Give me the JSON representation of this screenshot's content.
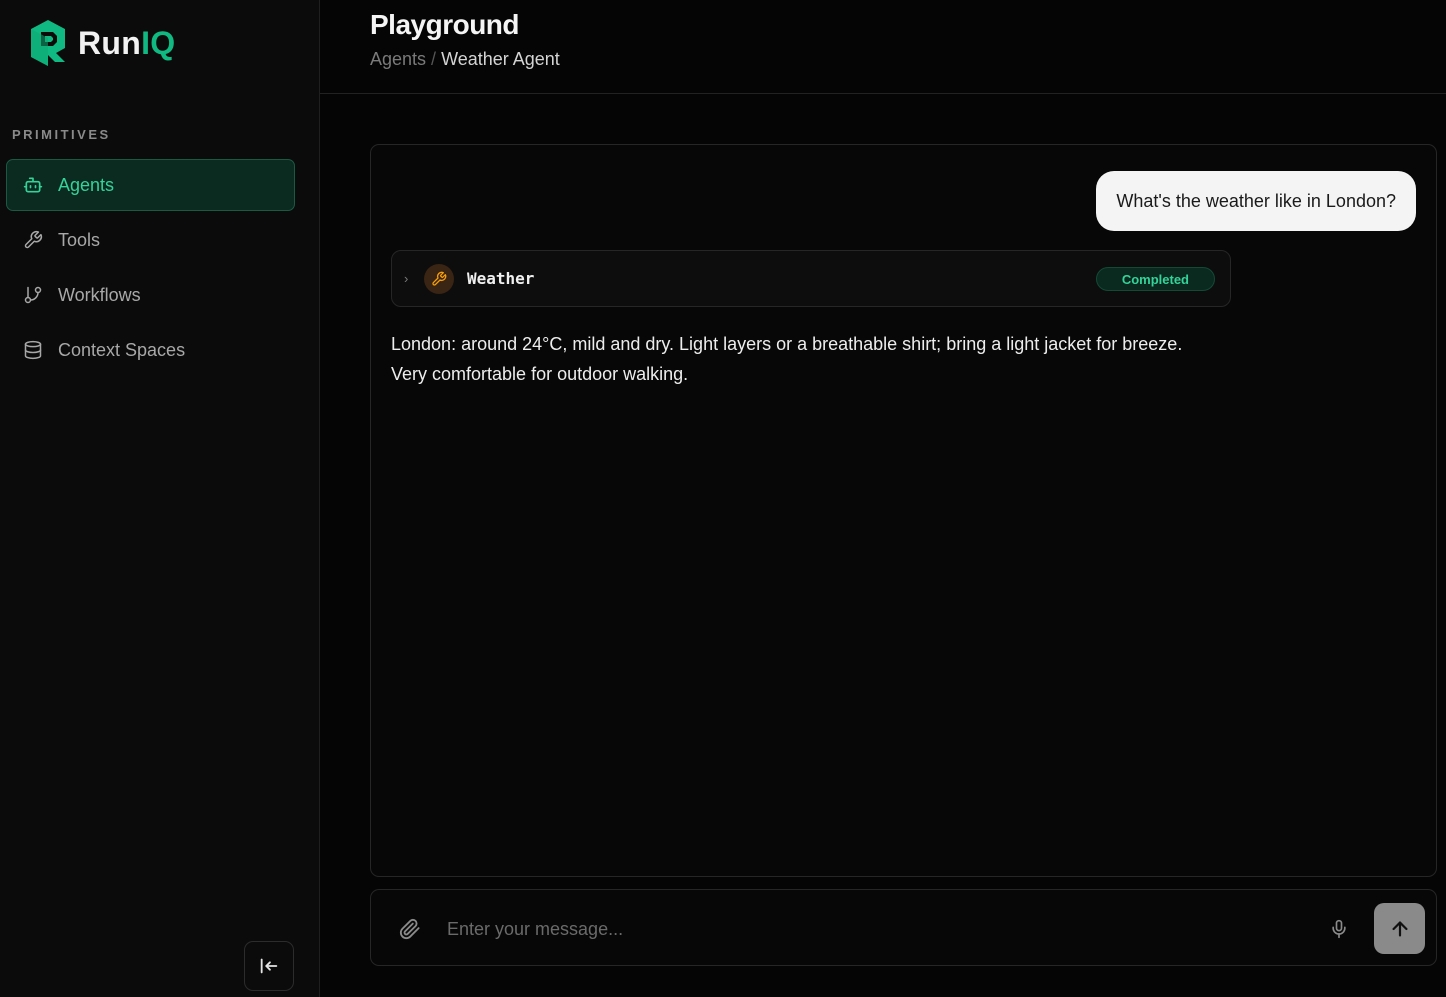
{
  "brand": {
    "name_prefix": "Run",
    "name_suffix": "IQ",
    "accent_color": "#10b981"
  },
  "sidebar": {
    "section_label": "PRIMITIVES",
    "items": [
      {
        "label": "Agents",
        "icon": "bot-icon",
        "active": true
      },
      {
        "label": "Tools",
        "icon": "wrench-icon",
        "active": false
      },
      {
        "label": "Workflows",
        "icon": "git-branch-icon",
        "active": false
      },
      {
        "label": "Context Spaces",
        "icon": "database-icon",
        "active": false
      }
    ],
    "collapse_icon": "collapse-left-icon"
  },
  "header": {
    "title": "Playground",
    "breadcrumb": [
      "Agents",
      "Weather Agent"
    ],
    "separator": "/"
  },
  "chat": {
    "user_message": "What's the weather like in London?",
    "tool_call": {
      "name": "Weather",
      "status": "Completed",
      "expand_glyph": "›"
    },
    "assistant_message": "London: around 24°C, mild and dry. Light layers or a breathable shirt; bring a light jacket for breeze. Very comfortable for outdoor walking."
  },
  "composer": {
    "placeholder": "Enter your message...",
    "attach_icon": "paperclip-icon",
    "mic_icon": "microphone-icon",
    "send_icon": "arrow-up-icon"
  }
}
